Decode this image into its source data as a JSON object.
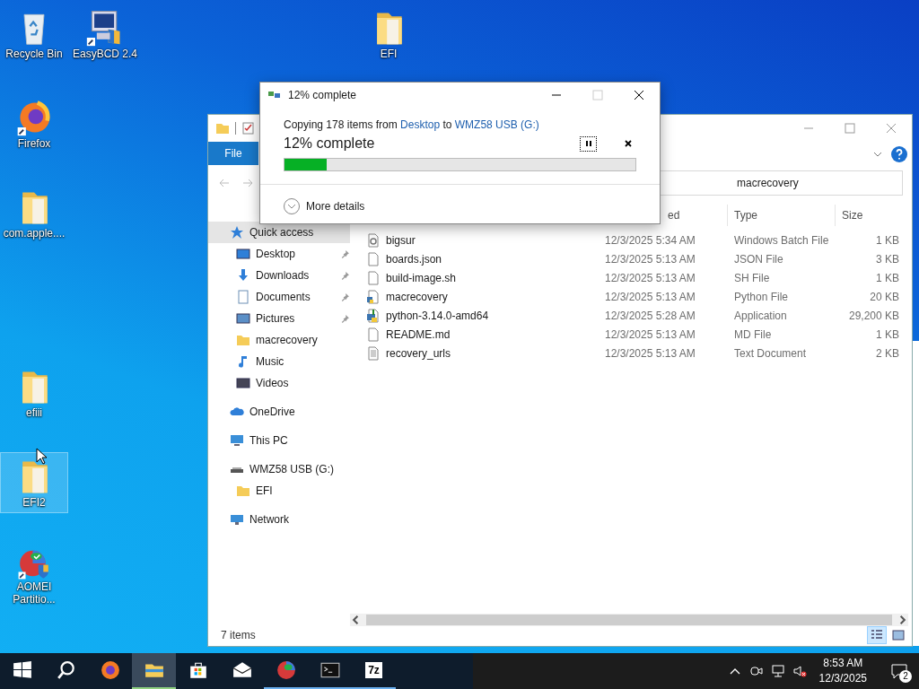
{
  "desktop_icons": [
    {
      "kind": "recycle-bin",
      "label": "Recycle Bin",
      "selected": false
    },
    {
      "kind": "app",
      "label": "EasyBCD 2.4",
      "selected": false
    },
    {
      "kind": "folder",
      "label": "EFI",
      "selected": false
    },
    {
      "kind": "firefox",
      "label": "Firefox",
      "selected": false
    },
    {
      "kind": "folder",
      "label": "com.apple....",
      "selected": false
    },
    {
      "kind": "folder",
      "label": "efiii",
      "selected": false
    },
    {
      "kind": "folder",
      "label": "EFI2",
      "selected": true
    },
    {
      "kind": "aomei",
      "label": "AOMEI Partitio...",
      "selected": false
    }
  ],
  "explorer": {
    "ribbon_tab": "File",
    "address": "macrecovery",
    "nav": [
      {
        "kind": "star",
        "label": "Quick access",
        "selected": true,
        "children": [
          {
            "kind": "desktop",
            "label": "Desktop",
            "pinned": true,
            "selected": false
          },
          {
            "kind": "downloads",
            "label": "Downloads",
            "pinned": true,
            "selected": false
          },
          {
            "kind": "documents",
            "label": "Documents",
            "pinned": true,
            "selected": false
          },
          {
            "kind": "pictures",
            "label": "Pictures",
            "pinned": true,
            "selected": false
          },
          {
            "kind": "folder",
            "label": "macrecovery",
            "pinned": false,
            "selected": false
          },
          {
            "kind": "music",
            "label": "Music",
            "pinned": false,
            "selected": false
          },
          {
            "kind": "videos",
            "label": "Videos",
            "pinned": false,
            "selected": false
          }
        ]
      },
      {
        "kind": "cloud",
        "label": "OneDrive",
        "selected": false
      },
      {
        "kind": "pc",
        "label": "This PC",
        "selected": false
      },
      {
        "kind": "drive",
        "label": "WMZ58 USB (G:)",
        "selected": false,
        "children": [
          {
            "kind": "folder",
            "label": "EFI",
            "pinned": false,
            "selected": false
          }
        ]
      },
      {
        "kind": "network",
        "label": "Network",
        "selected": false
      }
    ],
    "columns": [
      {
        "label": "ed"
      },
      {
        "label": "Type"
      },
      {
        "label": "Size"
      }
    ],
    "files": [
      {
        "kind": "batch",
        "name": "bigsur",
        "date": "12/3/2025 5:34 AM",
        "type": "Windows Batch File",
        "size": "1 KB"
      },
      {
        "kind": "file",
        "name": "boards.json",
        "date": "12/3/2025 5:13 AM",
        "type": "JSON File",
        "size": "3 KB"
      },
      {
        "kind": "file",
        "name": "build-image.sh",
        "date": "12/3/2025 5:13 AM",
        "type": "SH File",
        "size": "1 KB"
      },
      {
        "kind": "python",
        "name": "macrecovery",
        "date": "12/3/2025 5:13 AM",
        "type": "Python File",
        "size": "20 KB"
      },
      {
        "kind": "installer",
        "name": "python-3.14.0-amd64",
        "date": "12/3/2025 5:28 AM",
        "type": "Application",
        "size": "29,200 KB"
      },
      {
        "kind": "file",
        "name": "README.md",
        "date": "12/3/2025 5:13 AM",
        "type": "MD File",
        "size": "1 KB"
      },
      {
        "kind": "text",
        "name": "recovery_urls",
        "date": "12/3/2025 5:13 AM",
        "type": "Text Document",
        "size": "2 KB"
      }
    ],
    "status_text": "7 items",
    "views": [
      {
        "kind": "details",
        "selected": true
      },
      {
        "kind": "tiles",
        "selected": false
      }
    ]
  },
  "dialog": {
    "title": "12% complete",
    "copy_prefix": "Copying 178 items from",
    "source": "Desktop",
    "connector": "to",
    "destination": "WMZ58 USB (G:)",
    "heading": "12% complete",
    "level": 0.12,
    "details_label": "More details",
    "maximize_disabled": true
  },
  "taskbar": {
    "items": [
      {
        "kind": "start",
        "active": false,
        "running": false
      },
      {
        "kind": "search",
        "active": false,
        "running": false
      },
      {
        "kind": "firefox",
        "active": false,
        "running": false
      },
      {
        "kind": "explorer",
        "active": true,
        "running": true
      },
      {
        "kind": "store",
        "active": false,
        "running": false
      },
      {
        "kind": "mail",
        "active": false,
        "running": false
      },
      {
        "kind": "aomei",
        "active": false,
        "running": true
      },
      {
        "kind": "terminal",
        "active": false,
        "running": true
      },
      {
        "kind": "sevenzip",
        "label": "7z",
        "active": false,
        "running": true
      }
    ],
    "volume_muted": true,
    "clock": {
      "time": "8:53 AM",
      "date": "12/3/2025"
    },
    "notifications": "2"
  }
}
